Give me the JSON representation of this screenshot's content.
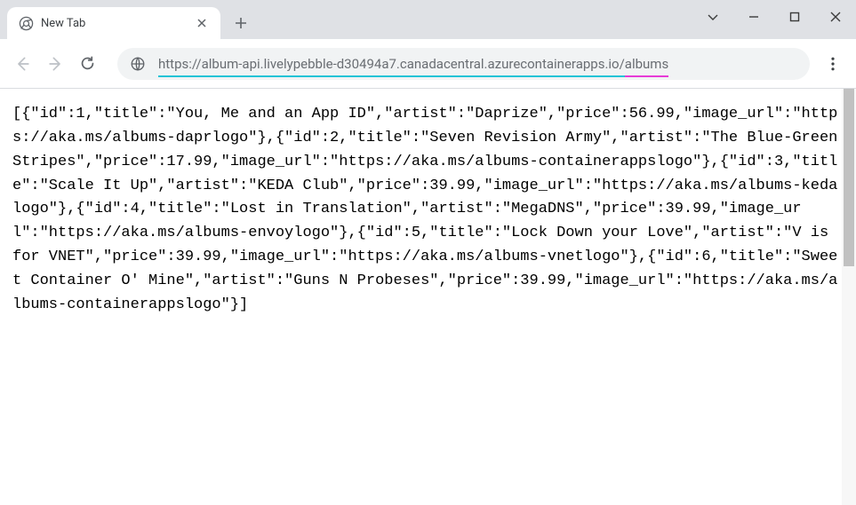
{
  "window": {
    "tab_title": "New Tab"
  },
  "toolbar": {
    "url_domain": "https://album-api.livelypebble-d30494a7.canadacentral.azurecontainerapps.io/",
    "url_path": "albums"
  },
  "body_text": "[{\"id\":1,\"title\":\"You, Me and an App ID\",\"artist\":\"Daprize\",\"price\":56.99,\"image_url\":\"https://aka.ms/albums-daprlogo\"},{\"id\":2,\"title\":\"Seven Revision Army\",\"artist\":\"The Blue-Green Stripes\",\"price\":17.99,\"image_url\":\"https://aka.ms/albums-containerappslogo\"},{\"id\":3,\"title\":\"Scale It Up\",\"artist\":\"KEDA Club\",\"price\":39.99,\"image_url\":\"https://aka.ms/albums-kedalogo\"},{\"id\":4,\"title\":\"Lost in Translation\",\"artist\":\"MegaDNS\",\"price\":39.99,\"image_url\":\"https://aka.ms/albums-envoylogo\"},{\"id\":5,\"title\":\"Lock Down your Love\",\"artist\":\"V is for VNET\",\"price\":39.99,\"image_url\":\"https://aka.ms/albums-vnetlogo\"},{\"id\":6,\"title\":\"Sweet Container O' Mine\",\"artist\":\"Guns N Probeses\",\"price\":39.99,\"image_url\":\"https://aka.ms/albums-containerappslogo\"}]"
}
